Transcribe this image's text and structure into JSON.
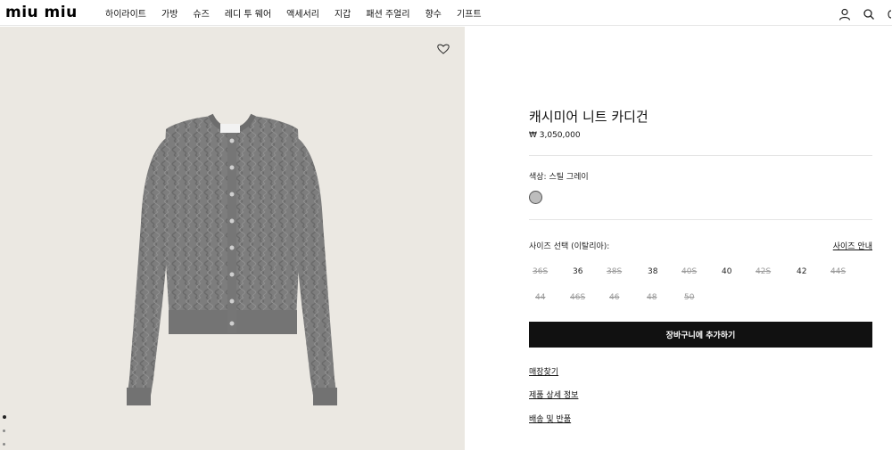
{
  "header": {
    "logo": "miu miu",
    "nav": [
      "하이라이트",
      "가방",
      "슈즈",
      "레디 투 웨어",
      "액세서리",
      "지갑",
      "패션 주얼리",
      "향수",
      "기프트"
    ],
    "icons": [
      "user-icon",
      "search-icon",
      "cart-icon"
    ]
  },
  "product": {
    "title": "캐시미어 니트 카디건",
    "price": "₩ 3,050,000",
    "color_label": "색상: 스틸 그레이",
    "swatch_color": "#bdbdbd",
    "size_label": "사이즈 선택 (이탈리아):",
    "size_guide": "사이즈 안내",
    "sizes": [
      {
        "label": "36S",
        "available": false
      },
      {
        "label": "36",
        "available": true
      },
      {
        "label": "38S",
        "available": false
      },
      {
        "label": "38",
        "available": true
      },
      {
        "label": "40S",
        "available": false
      },
      {
        "label": "40",
        "available": true
      },
      {
        "label": "42S",
        "available": false
      },
      {
        "label": "42",
        "available": true
      },
      {
        "label": "44S",
        "available": false
      },
      {
        "label": "44",
        "available": false
      },
      {
        "label": "46S",
        "available": false
      },
      {
        "label": "46",
        "available": false
      },
      {
        "label": "48",
        "available": false
      },
      {
        "label": "50",
        "available": false
      }
    ],
    "add_to_cart": "장바구니에 추가하기",
    "links": [
      "매장찾기",
      "제품 상세 정보",
      "배송 및 반품"
    ]
  },
  "gallery": {
    "image_dots": 3,
    "active_dot": 0
  }
}
